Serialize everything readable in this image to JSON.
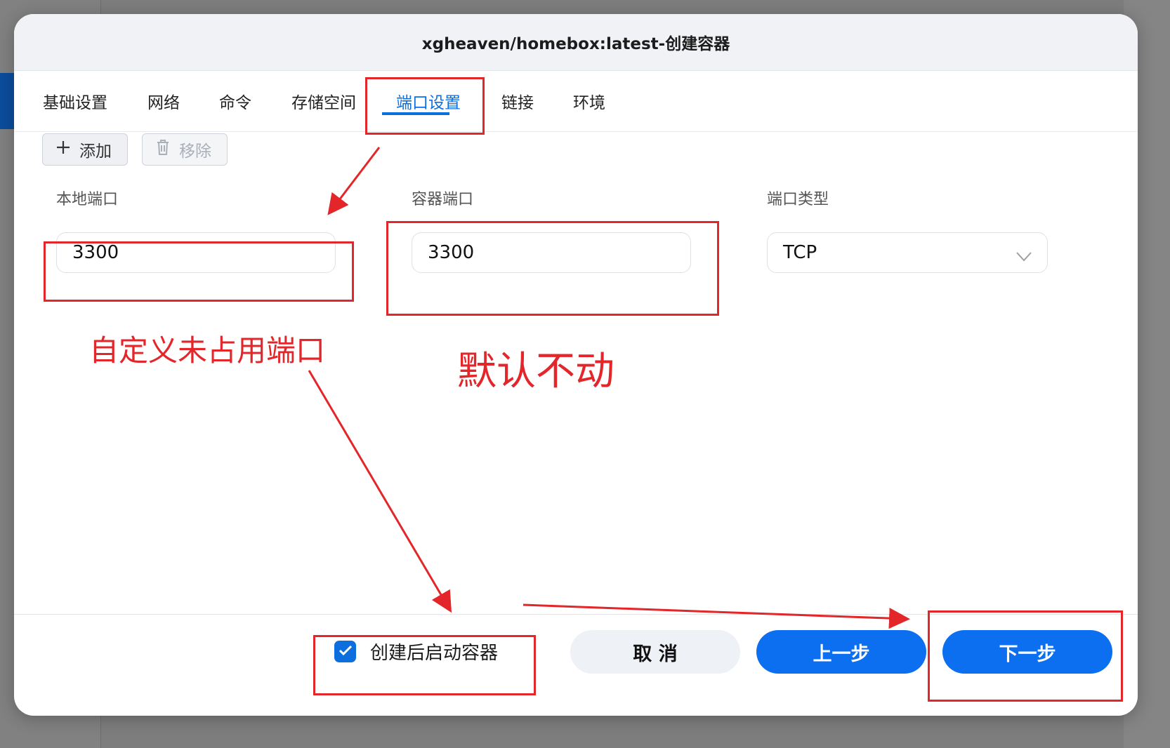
{
  "dialog": {
    "title": "xgheaven/homebox:latest-创建容器"
  },
  "tabs": [
    {
      "label": "基础设置"
    },
    {
      "label": "网络"
    },
    {
      "label": "命令"
    },
    {
      "label": "存储空间"
    },
    {
      "label": "端口设置",
      "active": true
    },
    {
      "label": "链接"
    },
    {
      "label": "环境"
    }
  ],
  "toolbar": {
    "add_label": "添加",
    "remove_label": "移除"
  },
  "port_row": {
    "local_port_label": "本地端口",
    "local_port_value": "3300",
    "container_port_label": "容器端口",
    "container_port_value": "3300",
    "port_type_label": "端口类型",
    "port_type_value": "TCP"
  },
  "footer": {
    "start_after_create_label": "创建后启动容器",
    "start_after_create_checked": true,
    "cancel_label": "取 消",
    "prev_label": "上一步",
    "next_label": "下一步"
  },
  "annotations": {
    "note_local_port": "自定义未占用端口",
    "note_container_port": "默认不动",
    "color": "#e3262a"
  },
  "colors": {
    "accent": "#0d6fde",
    "primary_button": "#0b6ff0"
  }
}
